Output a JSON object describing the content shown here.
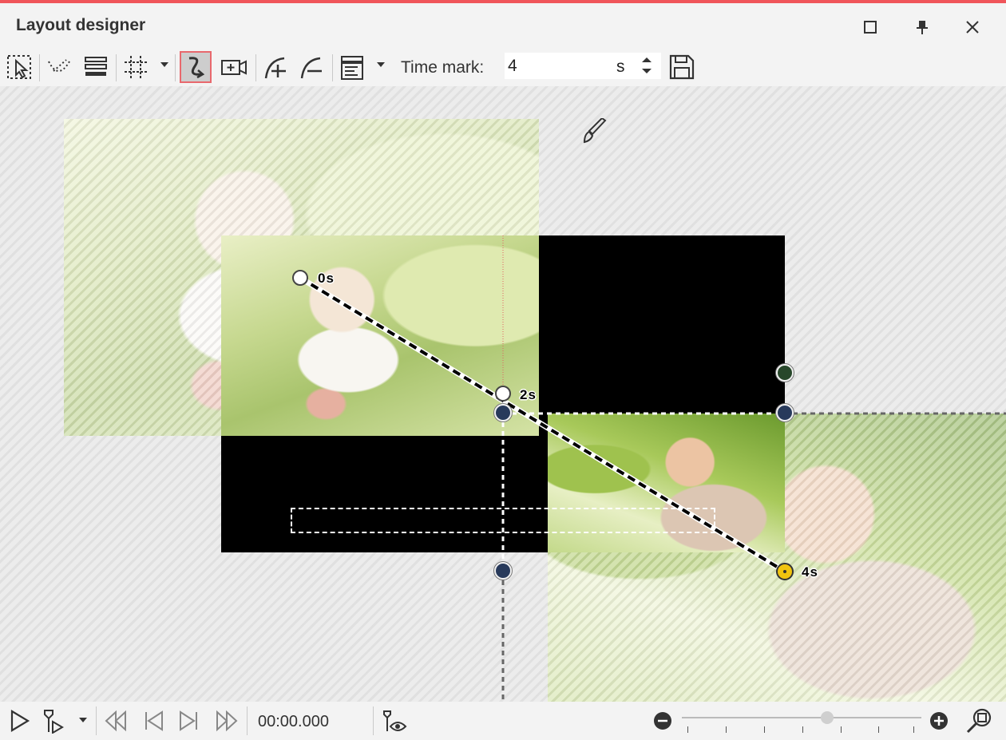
{
  "window": {
    "title": "Layout designer"
  },
  "toolbar": {
    "time_mark_label": "Time mark:",
    "time_mark_value": "4",
    "time_mark_unit": "s"
  },
  "canvas": {
    "path_labels": [
      "0s",
      "2s",
      "4s"
    ]
  },
  "playback": {
    "timecode": "00:00.000"
  },
  "colors": {
    "accent_red": "#f0555a",
    "node_navy": "#283a5b",
    "node_green": "#27472a",
    "keyframe_yellow": "#f1c40f"
  }
}
